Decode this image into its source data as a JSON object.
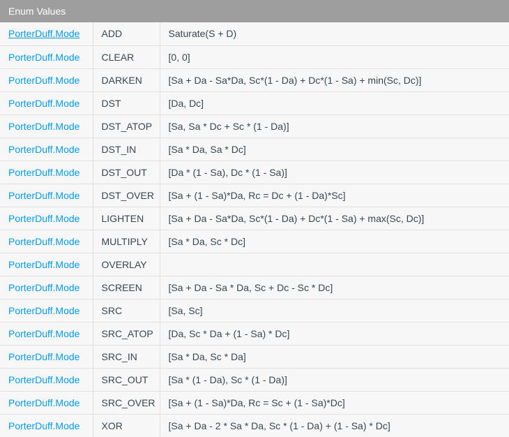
{
  "table": {
    "title": "Enum Values",
    "rows": [
      {
        "type": "PorterDuff.Mode",
        "name": "ADD",
        "formula": "Saturate(S + D)"
      },
      {
        "type": "PorterDuff.Mode",
        "name": "CLEAR",
        "formula": "[0, 0]"
      },
      {
        "type": "PorterDuff.Mode",
        "name": "DARKEN",
        "formula": "[Sa + Da - Sa*Da, Sc*(1 - Da) + Dc*(1 - Sa) + min(Sc, Dc)]"
      },
      {
        "type": "PorterDuff.Mode",
        "name": "DST",
        "formula": "[Da, Dc]"
      },
      {
        "type": "PorterDuff.Mode",
        "name": "DST_ATOP",
        "formula": "[Sa, Sa * Dc + Sc * (1 - Da)]"
      },
      {
        "type": "PorterDuff.Mode",
        "name": "DST_IN",
        "formula": "[Sa * Da, Sa * Dc]"
      },
      {
        "type": "PorterDuff.Mode",
        "name": "DST_OUT",
        "formula": "[Da * (1 - Sa), Dc * (1 - Sa)]"
      },
      {
        "type": "PorterDuff.Mode",
        "name": "DST_OVER",
        "formula": "[Sa + (1 - Sa)*Da, Rc = Dc + (1 - Da)*Sc]"
      },
      {
        "type": "PorterDuff.Mode",
        "name": "LIGHTEN",
        "formula": "[Sa + Da - Sa*Da, Sc*(1 - Da) + Dc*(1 - Sa) + max(Sc, Dc)]"
      },
      {
        "type": "PorterDuff.Mode",
        "name": "MULTIPLY",
        "formula": "[Sa * Da, Sc * Dc]"
      },
      {
        "type": "PorterDuff.Mode",
        "name": "OVERLAY",
        "formula": ""
      },
      {
        "type": "PorterDuff.Mode",
        "name": "SCREEN",
        "formula": "[Sa + Da - Sa * Da, Sc + Dc - Sc * Dc]"
      },
      {
        "type": "PorterDuff.Mode",
        "name": "SRC",
        "formula": "[Sa, Sc]"
      },
      {
        "type": "PorterDuff.Mode",
        "name": "SRC_ATOP",
        "formula": "[Da, Sc * Da + (1 - Sa) * Dc]"
      },
      {
        "type": "PorterDuff.Mode",
        "name": "SRC_IN",
        "formula": "[Sa * Da, Sc * Da]"
      },
      {
        "type": "PorterDuff.Mode",
        "name": "SRC_OUT",
        "formula": "[Sa * (1 - Da), Sc * (1 - Da)]"
      },
      {
        "type": "PorterDuff.Mode",
        "name": "SRC_OVER",
        "formula": "[Sa + (1 - Sa)*Da, Rc = Sc + (1 - Sa)*Dc]"
      },
      {
        "type": "PorterDuff.Mode",
        "name": "XOR",
        "formula": "[Sa + Da - 2 * Sa * Da, Sc * (1 - Da) + (1 - Sa) * Dc]"
      }
    ]
  },
  "colors": {
    "header_bg": "#9e9e9e",
    "link": "#039be5",
    "cell_bg": "#f7f7f7",
    "border": "#e0e0e0",
    "text": "#37474f"
  }
}
